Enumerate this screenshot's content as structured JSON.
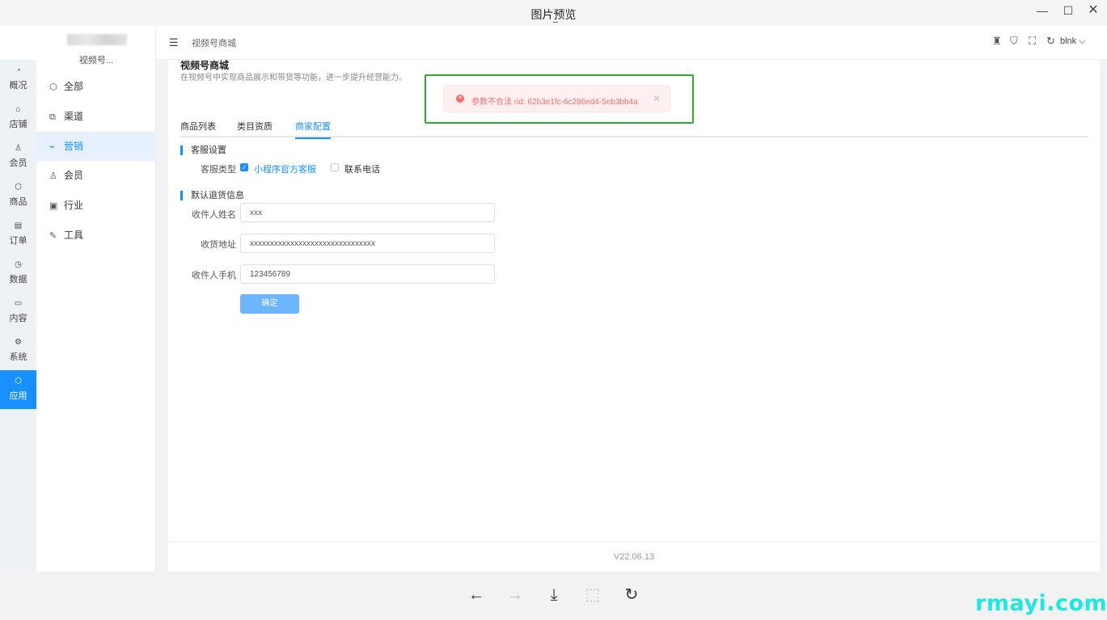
{
  "viewer": {
    "title": "图片预览",
    "minimize": "—",
    "maximize": "☐",
    "close": "✕"
  },
  "rail": {
    "items": [
      {
        "label": "概况",
        "icon": "◔"
      },
      {
        "label": "店铺",
        "icon": "⌂"
      },
      {
        "label": "会员",
        "icon": "♙"
      },
      {
        "label": "商品",
        "icon": "⬡"
      },
      {
        "label": "订单",
        "icon": "▤"
      },
      {
        "label": "数据",
        "icon": "◷"
      },
      {
        "label": "内容",
        "icon": "▭"
      },
      {
        "label": "系统",
        "icon": "⚙"
      },
      {
        "label": "应用",
        "icon": "⬡"
      }
    ]
  },
  "submenu": {
    "shop_name": "视频号...",
    "items": [
      {
        "label": "全部",
        "icon": "⬡"
      },
      {
        "label": "渠道",
        "icon": "⧉"
      },
      {
        "label": "营销",
        "icon": "⌁"
      },
      {
        "label": "会员",
        "icon": "♙"
      },
      {
        "label": "行业",
        "icon": "▣"
      },
      {
        "label": "工具",
        "icon": "✎"
      }
    ]
  },
  "topbar": {
    "menu_icon": "☰",
    "breadcrumb": "视频号商城",
    "user": "blnk ⌵"
  },
  "page": {
    "title": "视频号商城",
    "description": "在视频号中实现商品展示和带货等功能，进一步提升经营能力。"
  },
  "tabs": [
    "商品列表",
    "类目资质",
    "商家配置"
  ],
  "service": {
    "section_title": "客服设置",
    "type_label": "客服类型",
    "option_1": "小程序官方客服",
    "option_2": "联系电话"
  },
  "returns": {
    "section_title": "默认退货信息",
    "name_label": "收件人姓名",
    "name_value": "xxx",
    "address_label": "收货地址",
    "address_value": "xxxxxxxxxxxxxxxxxxxxxxxxxxxxxxx",
    "phone_label": "收件人手机",
    "phone_value": "123456789",
    "confirm": "确定"
  },
  "footer": {
    "version": "V22.06.13"
  },
  "toast": {
    "message": "参数不合法 rid: 62b3e1fc-6c286ed4-5eb3bb4a",
    "icon": "✕",
    "close": "✕"
  },
  "viewer_bar": {
    "back": "←",
    "forward": "→",
    "download": "⤓",
    "fit": "⬚",
    "rotate": "↻"
  },
  "watermark": "rmayi.com",
  "colors": {
    "accent": "#1890ff",
    "error": "#f56c6c",
    "highlight": "#2ea82e",
    "watermark": "#1ee8e0"
  }
}
